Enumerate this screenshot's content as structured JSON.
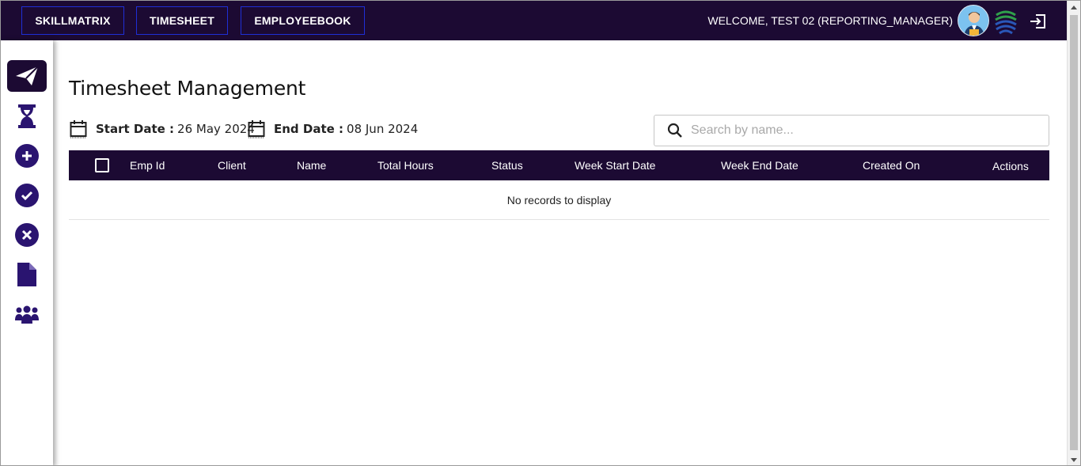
{
  "nav": {
    "buttons": [
      "SKILLMATRIX",
      "TIMESHEET",
      "EMPLOYEEBOOK"
    ],
    "welcome": "WELCOME, TEST 02 (REPORTING_MANAGER)"
  },
  "page": {
    "title": "Timesheet Management",
    "start_label": "Start Date :",
    "start_value": "26 May 2024",
    "end_label": "End Date :",
    "end_value": "08 Jun 2024"
  },
  "search": {
    "placeholder": "Search by name..."
  },
  "table": {
    "columns": [
      "Emp Id",
      "Client",
      "Name",
      "Total Hours",
      "Status",
      "Week Start Date",
      "Week End Date",
      "Created On",
      "Actions"
    ],
    "empty_message": "No records to display"
  },
  "colors": {
    "header_bg": "#1c0a33",
    "accent": "#2a1470",
    "nav_border": "#1f2fd6"
  },
  "sidebar": {
    "icons": [
      "paper-plane-icon",
      "hourglass-icon",
      "plus-circle-icon",
      "check-circle-icon",
      "x-circle-icon",
      "file-icon",
      "users-icon"
    ]
  }
}
